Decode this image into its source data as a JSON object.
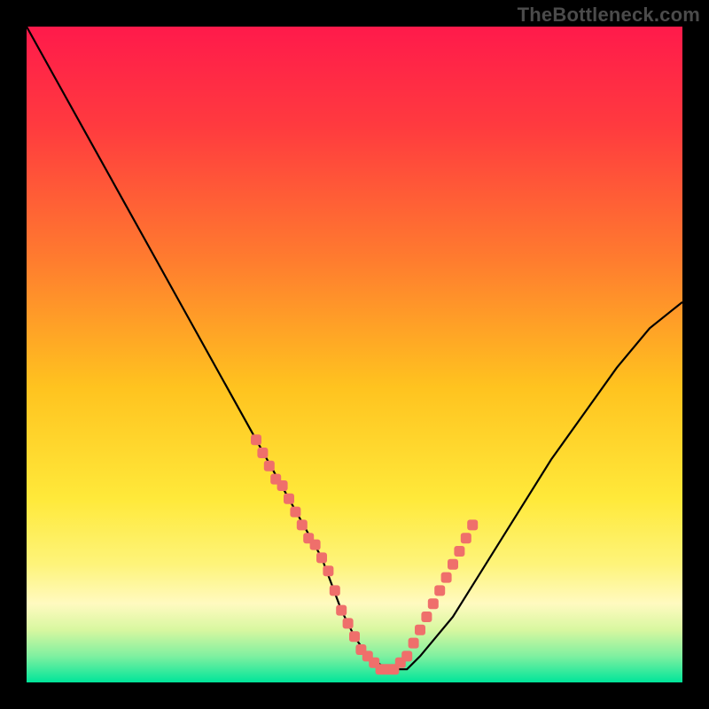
{
  "watermark": "TheBottleneck.com",
  "chart_data": {
    "type": "line",
    "title": "",
    "xlabel": "",
    "ylabel": "",
    "xlim": [
      0,
      100
    ],
    "ylim": [
      0,
      100
    ],
    "gradient_stops": [
      {
        "offset": 0.0,
        "color": "#ff1a4b"
      },
      {
        "offset": 0.15,
        "color": "#ff3a3f"
      },
      {
        "offset": 0.35,
        "color": "#ff7a2f"
      },
      {
        "offset": 0.55,
        "color": "#ffc31f"
      },
      {
        "offset": 0.72,
        "color": "#ffe93a"
      },
      {
        "offset": 0.82,
        "color": "#fef47a"
      },
      {
        "offset": 0.88,
        "color": "#fffac0"
      },
      {
        "offset": 0.92,
        "color": "#d8f7a0"
      },
      {
        "offset": 0.96,
        "color": "#7ff0a0"
      },
      {
        "offset": 1.0,
        "color": "#00e59a"
      }
    ],
    "series": [
      {
        "name": "bottleneck-curve",
        "color": "#000000",
        "x": [
          0,
          5,
          10,
          15,
          20,
          25,
          30,
          35,
          40,
          45,
          48,
          50,
          52,
          55,
          58,
          60,
          65,
          70,
          75,
          80,
          85,
          90,
          95,
          100
        ],
        "y": [
          100,
          91,
          82,
          73,
          64,
          55,
          46,
          37,
          28,
          19,
          11,
          7,
          4,
          2,
          2,
          4,
          10,
          18,
          26,
          34,
          41,
          48,
          54,
          58
        ]
      }
    ],
    "highlight_points": {
      "name": "highlighted-range",
      "color": "#ef6f6b",
      "x": [
        35,
        36,
        37,
        38,
        39,
        40,
        41,
        42,
        43,
        44,
        45,
        46,
        47,
        48,
        49,
        50,
        51,
        52,
        53,
        54,
        55,
        56,
        57,
        58,
        59,
        60,
        61,
        62,
        63,
        64,
        65,
        66,
        67,
        68
      ],
      "y": [
        37,
        35,
        33,
        31,
        30,
        28,
        26,
        24,
        22,
        21,
        19,
        17,
        14,
        11,
        9,
        7,
        5,
        4,
        3,
        2,
        2,
        2,
        3,
        4,
        6,
        8,
        10,
        12,
        14,
        16,
        18,
        20,
        22,
        24
      ]
    }
  }
}
